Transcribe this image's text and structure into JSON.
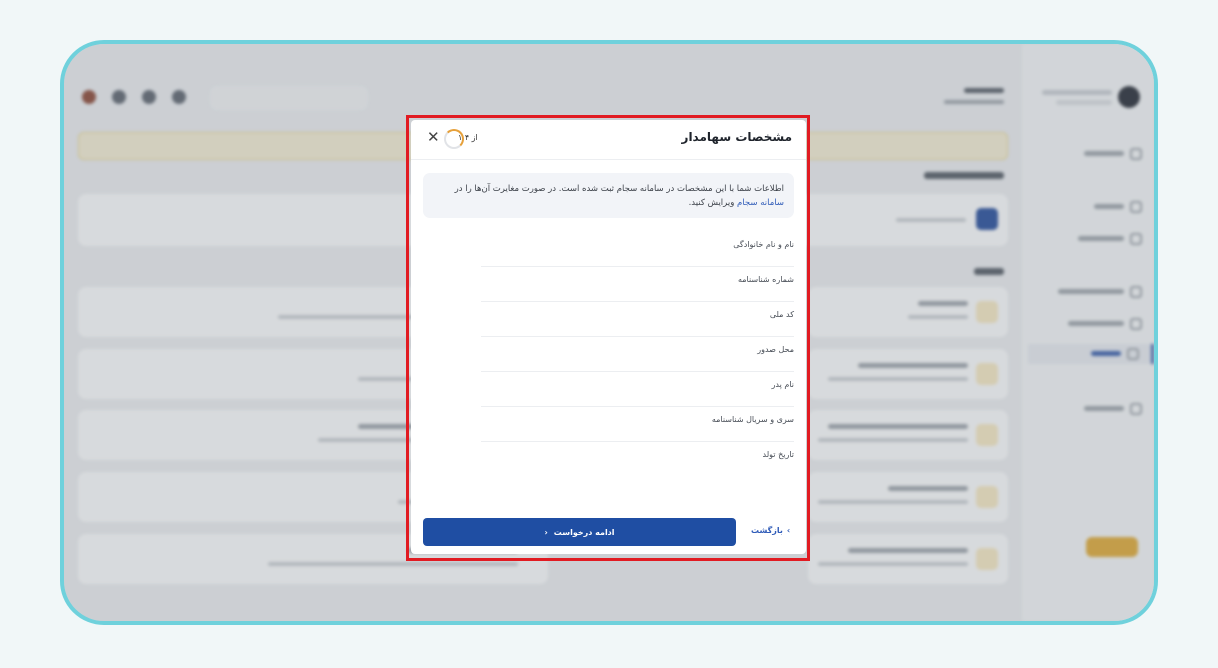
{
  "modal": {
    "title": "مشخصات سهامدار",
    "step": "۱ از ۴",
    "progress_fraction": 0.25,
    "close_icon": "close-icon",
    "info_text": "اطلاعات شما با این مشخصات در سامانه سجام ثبت شده است. در صورت مغایرت آن‌ها را در",
    "info_link": "سامانه سجام",
    "info_suffix": "ویرایش کنید.",
    "fields": [
      {
        "label": "نام و نام خانوادگی"
      },
      {
        "label": "شماره شناسنامه"
      },
      {
        "label": "کد ملی"
      },
      {
        "label": "محل صدور"
      },
      {
        "label": "نام پدر"
      },
      {
        "label": "سری و سریال شناسنامه"
      },
      {
        "label": "تاریخ تولد"
      }
    ],
    "continue_label": "ادامه درخواست",
    "back_label": "بازگشت"
  },
  "colors": {
    "primary": "#1f4ea3",
    "link": "#2f5bb8",
    "highlight_outline": "#e11b22",
    "frame_border": "#6fd1dc",
    "progress": "#e6a03a"
  }
}
